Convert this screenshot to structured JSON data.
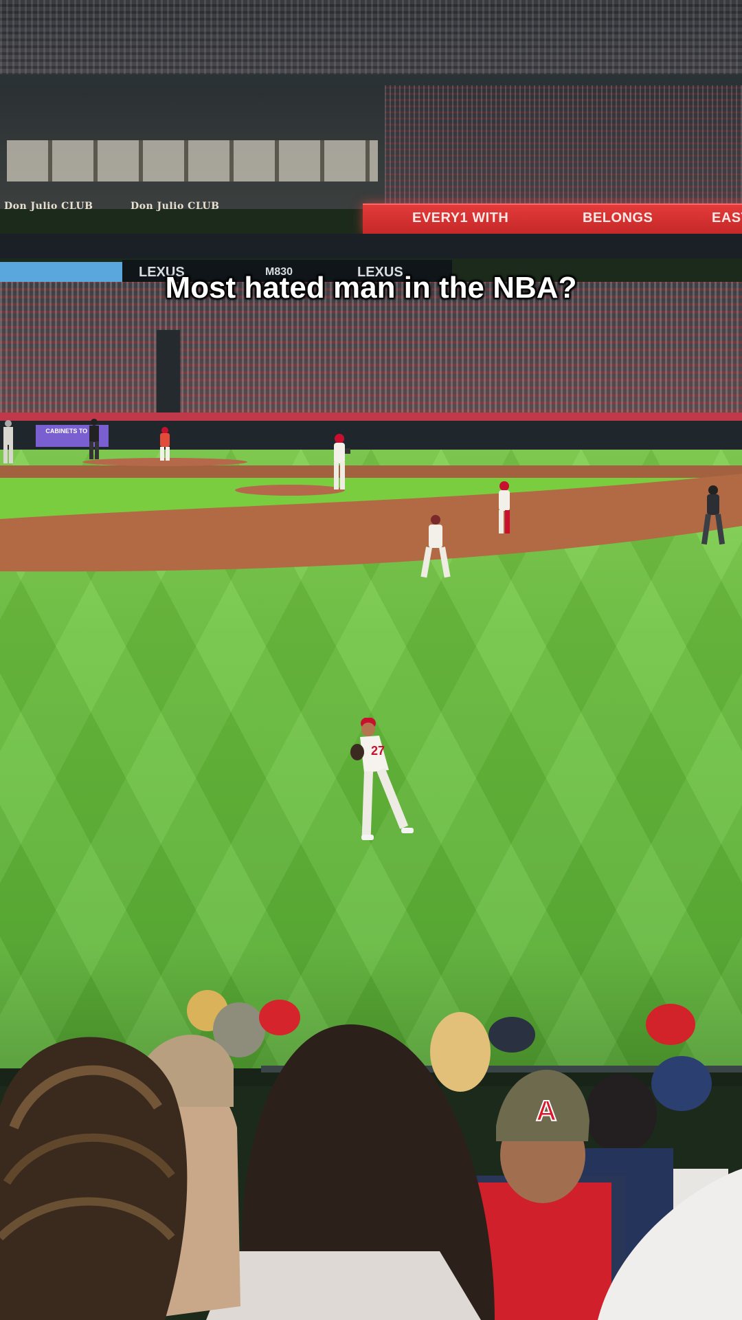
{
  "caption": "Most hated man in the NBA?",
  "scene": {
    "ribbon_text_1": "EVERY1 WITH",
    "ribbon_text_2": "BELONGS",
    "ribbon_text_3": "EAST",
    "club_sign": "Don Julio CLUB",
    "lexus_left": "LEXUS",
    "board_mid": "M830",
    "lexus_right": "LEXUS",
    "cab_sign": "CABINETS TO GO",
    "cap_logo": "A"
  },
  "colors": {
    "grass": "#6cc23f",
    "dirt": "#a2623f",
    "ribbon": "#e23b3a",
    "angels_red": "#c8102e",
    "caption_text": "#ffffff"
  }
}
